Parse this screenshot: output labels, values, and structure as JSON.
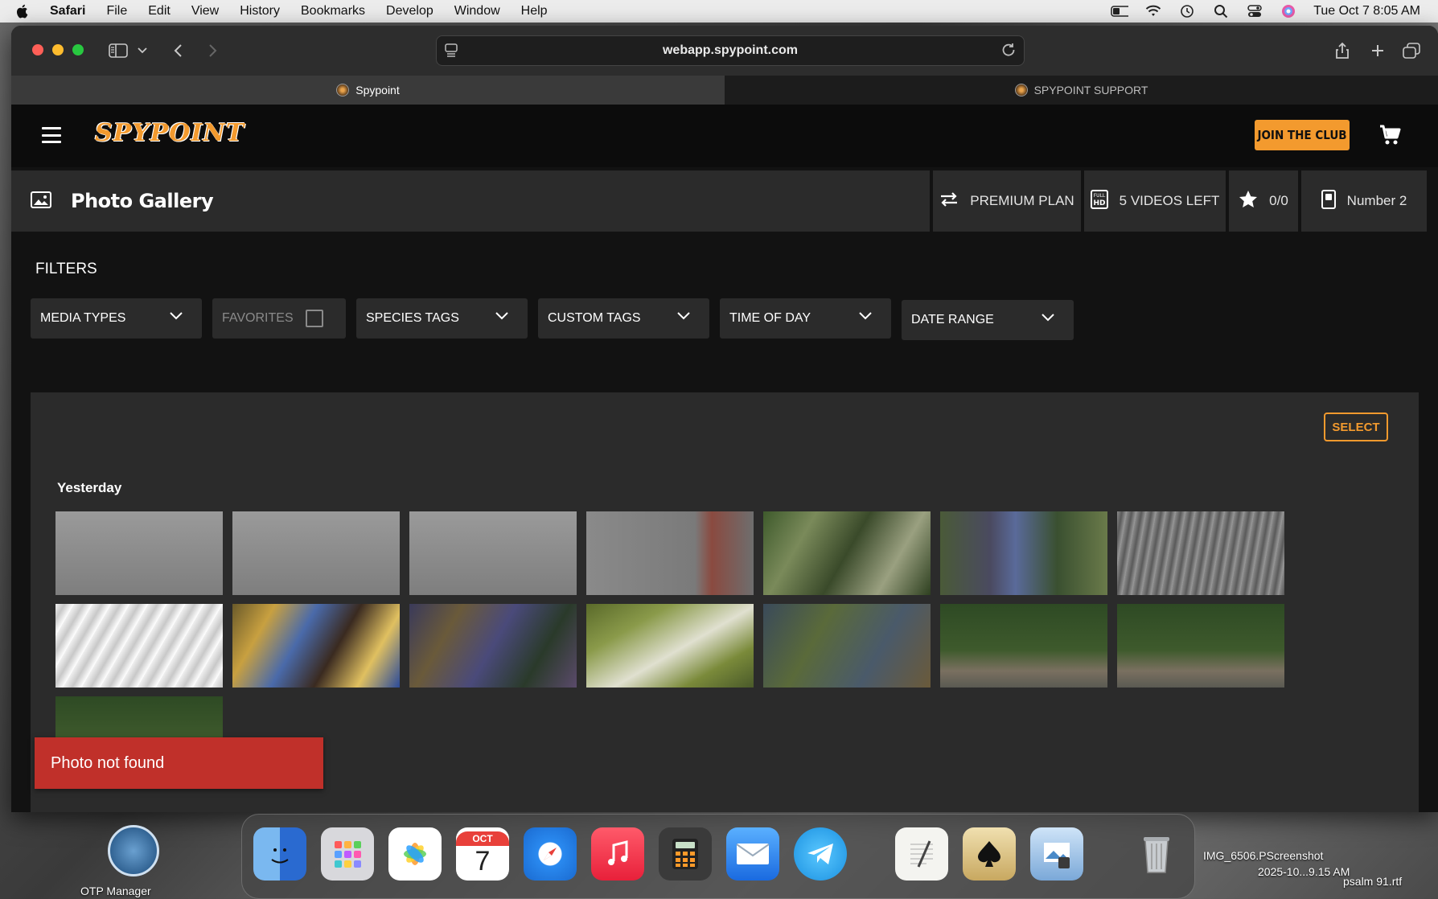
{
  "menubar": {
    "app_name": "Safari",
    "items": [
      "File",
      "Edit",
      "View",
      "History",
      "Bookmarks",
      "Develop",
      "Window",
      "Help"
    ],
    "datetime": "Tue Oct 7  8:05 AM"
  },
  "browser": {
    "url": "webapp.spypoint.com",
    "tabs": [
      {
        "label": "Spypoint",
        "active": true
      },
      {
        "label": "SPYPOINT SUPPORT",
        "active": false
      }
    ]
  },
  "header": {
    "logo_text": "SPYPOINT",
    "join_label": "JOIN THE CLUB"
  },
  "gallery_bar": {
    "title": "Photo Gallery",
    "plan": "PREMIUM PLAN",
    "videos_left": "5 VIDEOS LEFT",
    "favorites_count": "0/0",
    "camera_name": "Number 2"
  },
  "filters": {
    "heading": "FILTERS",
    "media_types": "MEDIA TYPES",
    "favorites": "FAVORITES",
    "species_tags": "SPECIES TAGS",
    "custom_tags": "CUSTOM TAGS",
    "time_of_day": "TIME OF DAY",
    "date_range": "DATE RANGE"
  },
  "gallery": {
    "select_label": "SELECT",
    "group_label": "Yesterday",
    "photo_count": 15
  },
  "toast": {
    "message": "Photo not found"
  },
  "desktop": {
    "left_label": "OTP Manager",
    "right_label_1": "IMG_6506.PScreenshot",
    "right_label_2": "2025-10...9.15 AM",
    "right_label_3": "psalm 91.rtf"
  },
  "dock": {
    "calendar_month": "OCT",
    "calendar_day": "7"
  },
  "colors": {
    "accent": "#f39a2e",
    "toast": "#c0302a",
    "panel": "#2b2b2b"
  }
}
